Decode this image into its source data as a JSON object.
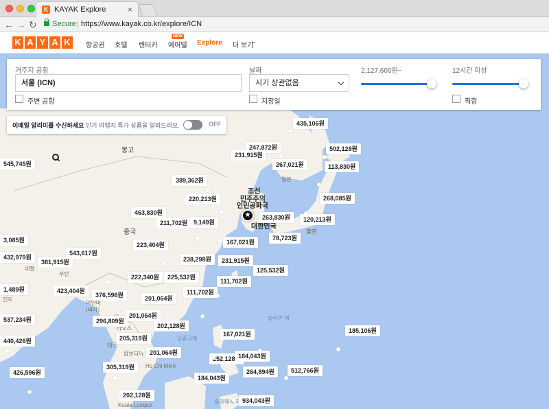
{
  "browser": {
    "tab_title": "KAYAK Explore",
    "tab_favicon": "K",
    "secure_label": "Secure",
    "url": "https://www.kayak.co.kr/explore/ICN"
  },
  "header": {
    "logo_letters": [
      "K",
      "A",
      "Y",
      "A",
      "K"
    ],
    "nav": [
      "항공권",
      "호텔",
      "렌터카",
      "에어텔",
      "Explore",
      "더 보기"
    ],
    "new_badge": "NEW",
    "accent_color": "#ff690f"
  },
  "filters": {
    "origin_label": "거주지 공항",
    "origin_value": "서울 (ICN)",
    "nearby_label": "주변 공항",
    "date_label": "날짜",
    "date_value": "시기 상관없음",
    "specific_date_label": "지정일",
    "price_label": "2,127,600원~",
    "price_level": 1.0,
    "duration_label": "12시간 이상",
    "duration_level": 1.0,
    "direct_label": "직항"
  },
  "email_bar": {
    "lead": "이메일 알리미를 수신하세요",
    "sub": "인기 여행지 특가 상품을 알려드려요.",
    "toggle_state": "OFF"
  },
  "map": {
    "labels": {
      "mongolia": "몽고",
      "china": "중국",
      "nkorea_1": "조선",
      "nkorea_2": "민주주의",
      "nkorea_3": "인민공화국",
      "skorea": "대한민국",
      "japan": "일본",
      "tokyo": "東京",
      "myanmar": "미얀마",
      "myanmar_2": "(버마)",
      "india": "인도",
      "nepal": "네팔",
      "bhutan": "부탄",
      "laos": "라오스",
      "thailand": "태국",
      "cambodia": "캄보디아",
      "hcm": "Ho Chi Minh",
      "kl": "Kuala Lumpur",
      "philippine_sea": "필리핀 해",
      "south_china_sea": "남중국해",
      "celebes_sea": "술라웨시 해"
    },
    "prices": [
      "435,106원",
      "247,872원",
      "502,128원",
      "267,021원",
      "113,830원",
      "231,915원",
      "389,362원",
      "220,213원",
      "268,085원",
      "463,830원",
      "211,702원",
      "9,149원",
      "263,830원",
      "120,213원",
      "545,745원",
      "78,723원",
      "167,021원",
      "223,404원",
      "543,617원",
      "432,979원",
      "381,915원",
      "238,298원",
      "231,915원",
      "125,532원",
      "222,340원",
      "225,532원",
      "111,702원",
      "423,404원",
      "376,596원",
      "111,702원",
      "201,064원",
      "1,489원",
      "537,234원",
      "296,809원",
      "201,064원",
      "202,128원",
      "205,319원",
      "440,426원",
      "167,021원",
      "185,106원",
      "201,064원",
      "252,128원",
      "184,043원",
      "426,596원",
      "305,319원",
      "264,894원",
      "184,043원",
      "512,766원",
      "202,128원",
      "934,043원",
      "3,085원"
    ]
  }
}
